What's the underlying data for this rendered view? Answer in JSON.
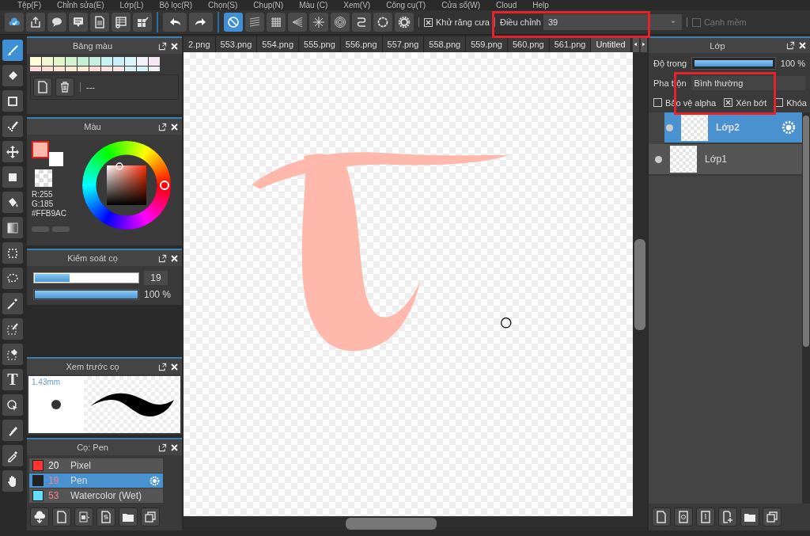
{
  "menu": [
    "Tệp(F)",
    "Chỉnh sửa(E)",
    "Lớp(L)",
    "Bộ lọc(R)",
    "Chọn(S)",
    "Chụp(N)",
    "Màu (C)",
    "Xem(V)",
    "Công cụ(T)",
    "Cửa sổ(W)",
    "Cloud",
    "Help"
  ],
  "snap_modes": [
    {
      "selected": true
    },
    {
      "selected": false
    },
    {
      "selected": false
    },
    {
      "selected": false
    },
    {
      "selected": false
    },
    {
      "selected": false
    },
    {
      "selected": false
    },
    {
      "selected": false
    }
  ],
  "antialias": {
    "label": "Khử răng cưa",
    "checked": true
  },
  "adjust": {
    "label": "Điều chỉnh",
    "value": "39"
  },
  "soft_edge": {
    "label": "Cạnh mềm",
    "checked": false,
    "disabled": true
  },
  "file_tabs": [
    {
      "label": "2.png",
      "selected": false
    },
    {
      "label": "553.png",
      "selected": false
    },
    {
      "label": "554.png",
      "selected": false
    },
    {
      "label": "555.png",
      "selected": false
    },
    {
      "label": "556.png",
      "selected": false
    },
    {
      "label": "557.png",
      "selected": false
    },
    {
      "label": "558.png",
      "selected": false
    },
    {
      "label": "559.png",
      "selected": false
    },
    {
      "label": "560.png",
      "selected": false
    },
    {
      "label": "561.png",
      "selected": false
    },
    {
      "label": "Untitled",
      "selected": true
    }
  ],
  "tools": [
    {
      "selected": true
    },
    {
      "selected": false
    },
    {
      "selected": false
    },
    {
      "selected": false
    },
    {
      "selected": false
    },
    {
      "selected": false
    },
    {
      "selected": false
    },
    {
      "selected": false
    },
    {
      "selected": false
    },
    {
      "selected": false
    },
    {
      "selected": false
    },
    {
      "selected": false
    },
    {
      "selected": false
    },
    {
      "selected": false,
      "glyph": "T"
    },
    {
      "selected": false
    },
    {
      "selected": false
    },
    {
      "selected": false
    },
    {
      "selected": false
    }
  ],
  "palette": {
    "title": "Bảng màu",
    "name": "---",
    "swatches": [
      {
        "color": "#fffbd9"
      },
      {
        "color": "#f1f7d2"
      },
      {
        "color": "#e4f5cc"
      },
      {
        "color": "#d2f2d2"
      },
      {
        "color": "#c8efd6"
      },
      {
        "color": "#c8efe2"
      },
      {
        "color": "#c8f2f2"
      },
      {
        "color": "#cdeef8"
      },
      {
        "color": "#dbf5fa"
      },
      {
        "color": "#f5f1fb"
      },
      {
        "color": "#f7e6f6"
      },
      {
        "color": "#fcd8d8"
      },
      {
        "color": "#fcdcd4"
      },
      {
        "color": "#fde2d2"
      },
      {
        "color": "#fde8d2"
      },
      {
        "color": "#fdecd4"
      },
      {
        "color": "#fcdcd8"
      },
      {
        "color": "#fbe0e0"
      },
      {
        "color": "#f6e4e6"
      },
      {
        "color": "#d8f0f4"
      },
      {
        "color": "#d6f3f6"
      },
      {
        "color": "#f0f0f0"
      }
    ]
  },
  "color_panel": {
    "title": "Màu",
    "primary": {
      "color": "#ffb9ac"
    },
    "r": "R:255",
    "g": "G:185",
    "hex": "#FFB9AC"
  },
  "brush_control": {
    "title": "Kiểm soát cọ",
    "size": {
      "level": 0.34,
      "value": "19"
    },
    "opacity": {
      "level": 1.0,
      "value": "100 %"
    }
  },
  "brush_preview": {
    "title": "Xem trước cọ",
    "size": "1.43mm"
  },
  "brush_list": {
    "title": "Cọ: Pen",
    "items": [
      {
        "color": "#ff3333",
        "number": "20",
        "name": "Pixel",
        "selected": false
      },
      {
        "color": "#222222",
        "number": "19",
        "name": "Pen",
        "selected": true
      },
      {
        "color": "#66ddff",
        "number": "53",
        "name": "Watercolor (Wet)",
        "selected": false
      }
    ]
  },
  "layers": {
    "title": "Lớp",
    "opacity_label": "Độ trong",
    "opacity": {
      "level": 1.0,
      "value": "100 %"
    },
    "blend_label": "Pha trộn",
    "blend": "Bình thường",
    "options": [
      {
        "label": "Bảo vệ alpha",
        "checked": false
      },
      {
        "label": "Xén bớt",
        "checked": true
      },
      {
        "label": "Khóa",
        "checked": false
      }
    ],
    "items": [
      {
        "name": "Lớp2",
        "selected": true,
        "visible": true
      },
      {
        "name": "Lớp1",
        "selected": false,
        "visible": true
      }
    ]
  }
}
